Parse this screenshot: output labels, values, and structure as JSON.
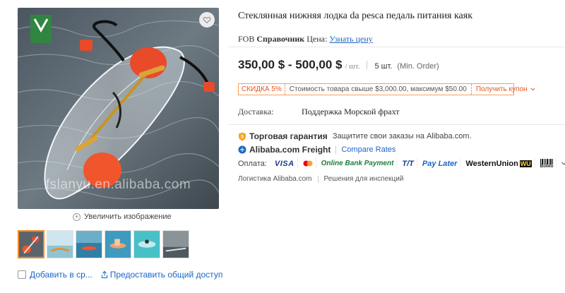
{
  "product": {
    "title": "Стеклянная нижняя лодка da pesca педаль питания каяк",
    "watermark": "fslanyu.en.alibaba.com"
  },
  "gallery": {
    "zoom_label": "Увеличить изображение",
    "add_to_compare": "Добавить в ср...",
    "share": "Предоставить общий доступ",
    "thumbnail_count": 6
  },
  "fob": {
    "fob": "FOB",
    "reference": "Справочник",
    "price_label": "Цена:",
    "learn_price": "Узнать цену"
  },
  "pricing": {
    "range": "350,00 $ - 500,00 $",
    "unit": "/ шт.",
    "moq": "5 шт.",
    "moq_note": "(Min. Order)"
  },
  "discount": {
    "tag": "СКИДКА 5%",
    "text": "Стоимость товара свыше $3,000.00, максимум $50.00",
    "coupon": "Получить купон"
  },
  "shipping": {
    "label": "Доставка:",
    "value": "Поддержка Морской фрахт"
  },
  "trade_assurance": {
    "label": "Торговая гарантия",
    "note": "Защитите свои заказы на Alibaba.com."
  },
  "freight": {
    "label": "Alibaba.com Freight",
    "compare": "Compare Rates"
  },
  "payment": {
    "label": "Оплата:",
    "methods": [
      "VISA",
      "Online Bank Payment",
      "T/T",
      "Pay Later",
      "WesternUnion",
      "Boleto"
    ]
  },
  "services": {
    "logistics": "Логистика Alibaba.com",
    "inspection": "Решения для инспекций"
  },
  "colors": {
    "link": "#1a66c8",
    "accent_orange": "#e8541e",
    "coupon_border": "#f6a05a",
    "thumb_active": "#f08a24"
  }
}
